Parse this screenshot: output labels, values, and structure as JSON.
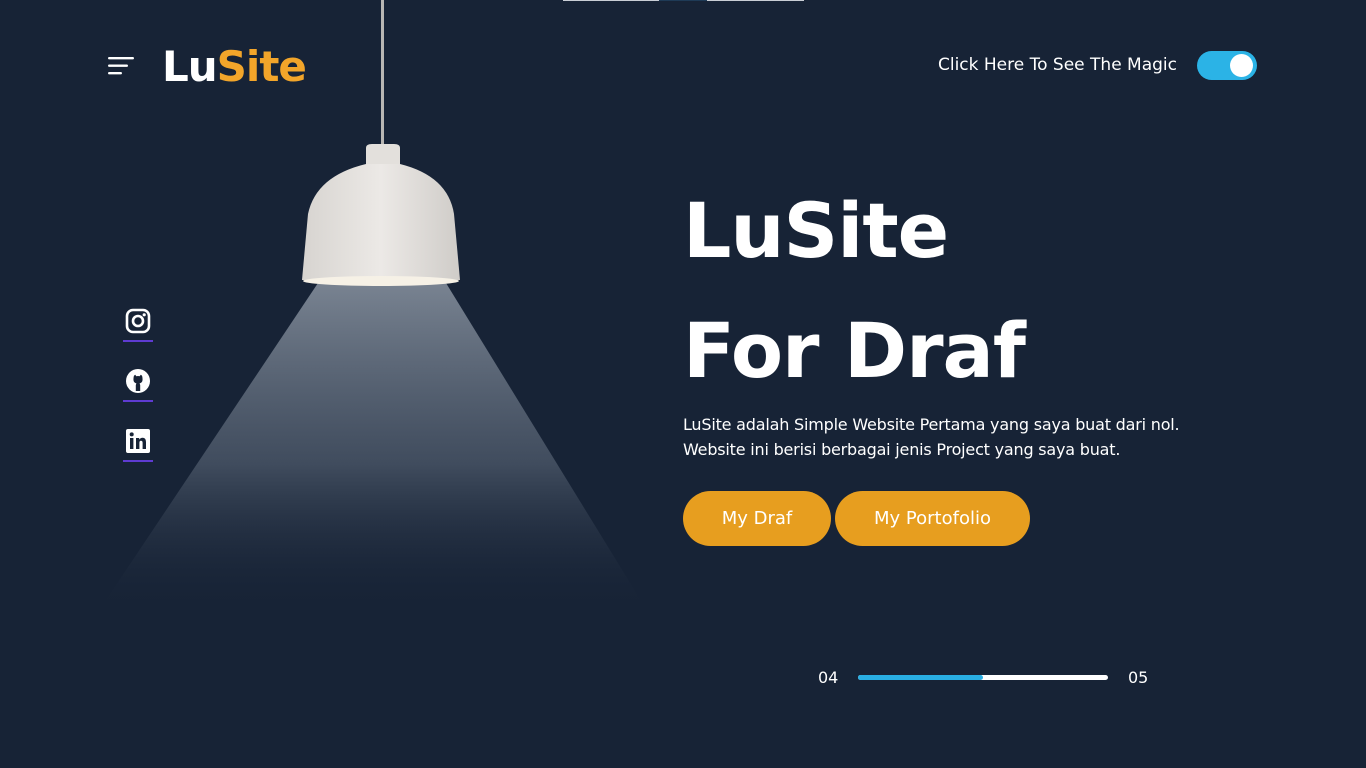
{
  "header": {
    "logo_part1": "Lu",
    "logo_part2": "Site",
    "toggle_label": "Click Here To See The Magic",
    "toggle_on": true,
    "icon_menu": "menu-icon"
  },
  "social": [
    {
      "icon": "instagram-icon"
    },
    {
      "icon": "github-icon"
    },
    {
      "icon": "linkedin-icon"
    }
  ],
  "hero": {
    "title_line1": "LuSite",
    "title_line2": "For Draf",
    "desc_line1": "LuSite adalah Simple Website Pertama yang saya buat dari nol.",
    "desc_line2": "Website ini berisi berbagai jenis Project yang saya buat.",
    "button_primary": "My Draf",
    "button_secondary": "My Portofolio"
  },
  "slider": {
    "current": "04",
    "total": "05",
    "progress": 0.5
  },
  "colors": {
    "background": "#172336",
    "accent_orange": "#f2a52a",
    "button_orange": "#e79e1f",
    "accent_blue": "#29aee3",
    "social_underline": "#5e3bd1"
  }
}
